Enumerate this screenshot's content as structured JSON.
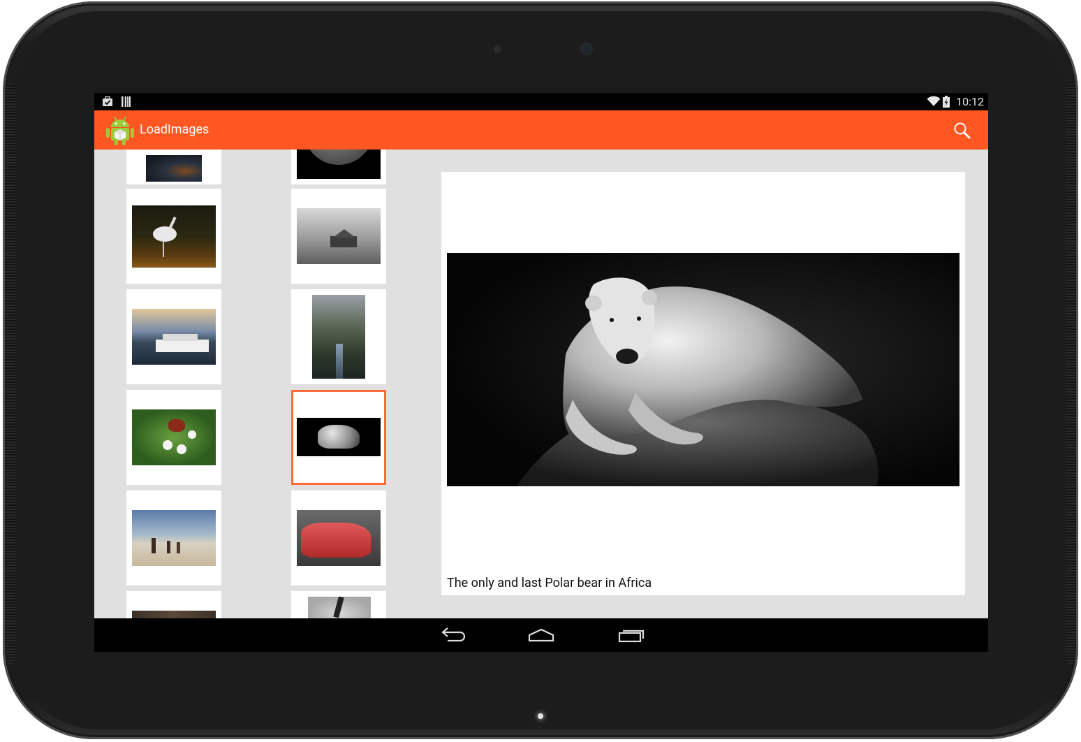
{
  "status_bar": {
    "time": "10:12",
    "notification_icons": [
      "briefcase-check-icon",
      "barcode-icon"
    ],
    "system_icons": [
      "wifi-icon",
      "battery-icon"
    ]
  },
  "action_bar": {
    "app_title": "LoadImages",
    "app_icon": "android-app-icon",
    "action_icon": "search-icon",
    "color": "#ff5722"
  },
  "gallery": {
    "selected_index": 7,
    "accent_color": "#ff6a3a",
    "thumbnails": [
      {
        "subject": "night landscape"
      },
      {
        "subject": "moon"
      },
      {
        "subject": "heron wading"
      },
      {
        "subject": "barn in fog"
      },
      {
        "subject": "boat on lake"
      },
      {
        "subject": "fjord"
      },
      {
        "subject": "butterfly on flowers"
      },
      {
        "subject": "polar bear"
      },
      {
        "subject": "people on beach"
      },
      {
        "subject": "red car"
      },
      {
        "subject": "animals"
      },
      {
        "subject": "hand silhouette"
      }
    ]
  },
  "detail": {
    "caption": "The only and last Polar bear in Africa",
    "image_subject": "polar bear resting on rock"
  },
  "navigation_bar": {
    "buttons": [
      "back-icon",
      "home-icon",
      "recent-apps-icon"
    ]
  }
}
